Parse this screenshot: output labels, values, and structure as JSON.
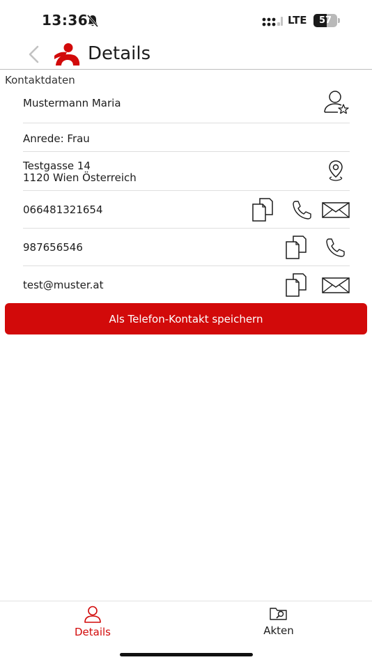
{
  "status_bar": {
    "time": "13:36",
    "network": "LTE",
    "battery_level": "57",
    "battery_fraction": 0.57,
    "silent_icon": "bell-slash-icon",
    "signal_icon": "cellular-signal-icon"
  },
  "header": {
    "back_icon": "chevron-left-icon",
    "logo_icon": "app-logo-icon",
    "title": "Details"
  },
  "section": {
    "title": "Kontaktdaten"
  },
  "contact": {
    "name": "Mustermann Maria",
    "salutation": "Anrede: Frau",
    "address_line1": "Testgasse 14",
    "address_line2": "1120 Wien Österreich",
    "phone1": "066481321654",
    "phone2": "987656546",
    "email": "test@muster.at"
  },
  "actions": {
    "save_label": "Als Telefon-Kontakt speichern"
  },
  "tabs": [
    {
      "label": "Details",
      "icon": "person-icon",
      "active": true
    },
    {
      "label": "Akten",
      "icon": "folder-search-icon",
      "active": false
    }
  ],
  "colors": {
    "accent": "#d20a0a",
    "text": "#1c1c1c",
    "divider": "#dedede"
  }
}
